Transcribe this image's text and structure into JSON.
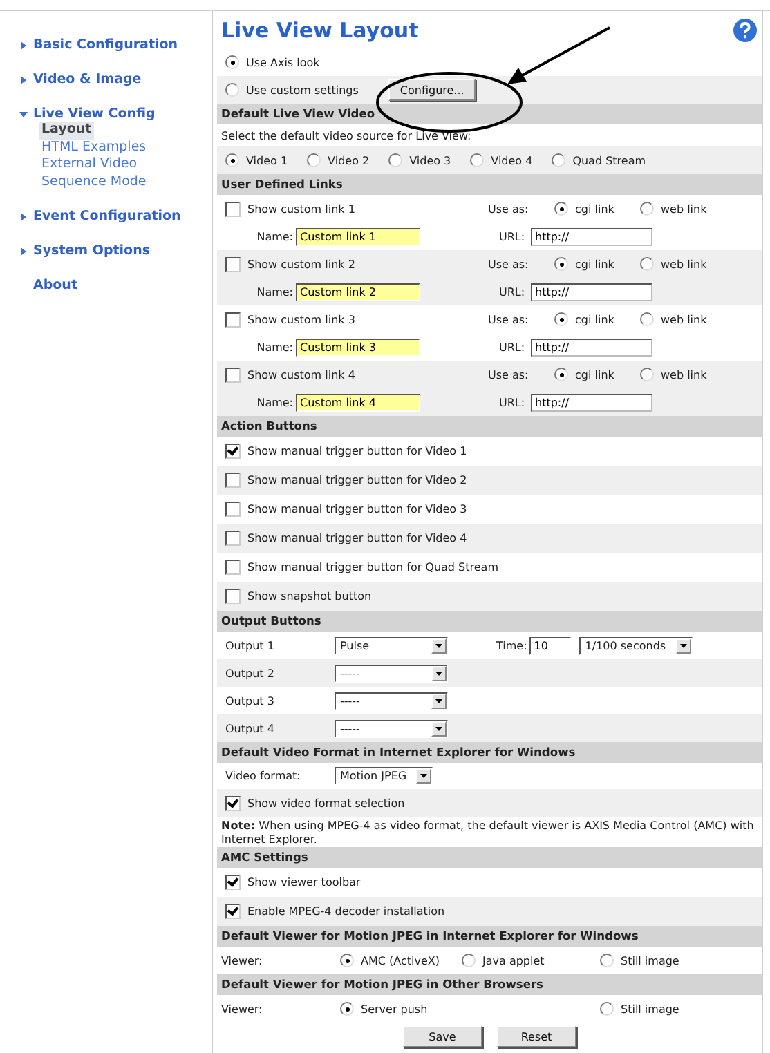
{
  "sidebar": {
    "items": [
      {
        "label": "Basic Configuration",
        "kind": "group",
        "expanded": false
      },
      {
        "label": "Video & Image",
        "kind": "group",
        "expanded": false
      },
      {
        "label": "Live View Config",
        "kind": "group",
        "expanded": true,
        "children": [
          {
            "label": "Layout",
            "selected": true
          },
          {
            "label": "HTML Examples",
            "selected": false
          },
          {
            "label": "External Video",
            "selected": false
          },
          {
            "label": "Sequence Mode",
            "selected": false
          }
        ]
      },
      {
        "label": "Event Configuration",
        "kind": "group",
        "expanded": false
      },
      {
        "label": "System Options",
        "kind": "group",
        "expanded": false
      },
      {
        "label": "About",
        "kind": "link"
      }
    ]
  },
  "title": "Live View Layout",
  "look": {
    "options": [
      {
        "label": "Use Axis look",
        "selected": true
      },
      {
        "label": "Use custom settings",
        "selected": false
      }
    ],
    "configure_button": "Configure..."
  },
  "default_video": {
    "heading": "Default Live View Video",
    "hint": "Select the default video source for Live View:",
    "options": [
      {
        "label": "Video 1",
        "selected": true
      },
      {
        "label": "Video 2",
        "selected": false
      },
      {
        "label": "Video 3",
        "selected": false
      },
      {
        "label": "Video 4",
        "selected": false
      },
      {
        "label": "Quad Stream",
        "selected": false
      }
    ]
  },
  "user_links": {
    "heading": "User Defined Links",
    "links": [
      {
        "label": "Show custom link 1",
        "checked": false,
        "use_as_label": "Use as:",
        "options": [
          {
            "label": "cgi link",
            "selected": true
          },
          {
            "label": "web link",
            "selected": false
          }
        ],
        "name_label": "Name:",
        "name_value": "Custom link 1",
        "url_label": "URL:",
        "url_value": "http://"
      },
      {
        "label": "Show custom link 2",
        "checked": false,
        "use_as_label": "Use as:",
        "options": [
          {
            "label": "cgi link",
            "selected": true
          },
          {
            "label": "web link",
            "selected": false
          }
        ],
        "name_label": "Name:",
        "name_value": "Custom link 2",
        "url_label": "URL:",
        "url_value": "http://"
      },
      {
        "label": "Show custom link 3",
        "checked": false,
        "use_as_label": "Use as:",
        "options": [
          {
            "label": "cgi link",
            "selected": true
          },
          {
            "label": "web link",
            "selected": false
          }
        ],
        "name_label": "Name:",
        "name_value": "Custom link 3",
        "url_label": "URL:",
        "url_value": "http://"
      },
      {
        "label": "Show custom link 4",
        "checked": false,
        "use_as_label": "Use as:",
        "options": [
          {
            "label": "cgi link",
            "selected": true
          },
          {
            "label": "web link",
            "selected": false
          }
        ],
        "name_label": "Name:",
        "name_value": "Custom link 4",
        "url_label": "URL:",
        "url_value": "http://"
      }
    ]
  },
  "action_buttons": {
    "heading": "Action Buttons",
    "items": [
      {
        "label": "Show manual trigger button for Video 1",
        "checked": true
      },
      {
        "label": "Show manual trigger button for Video 2",
        "checked": false
      },
      {
        "label": "Show manual trigger button for Video 3",
        "checked": false
      },
      {
        "label": "Show manual trigger button for Video 4",
        "checked": false
      },
      {
        "label": "Show manual trigger button for Quad Stream",
        "checked": false
      },
      {
        "label": "Show snapshot button",
        "checked": false
      }
    ]
  },
  "output_buttons": {
    "heading": "Output Buttons",
    "rows": [
      {
        "label": "Output 1",
        "value": "Pulse",
        "time_label": "Time:",
        "time_value": "10",
        "unit": "1/100 seconds"
      },
      {
        "label": "Output 2",
        "value": "-----"
      },
      {
        "label": "Output 3",
        "value": "-----"
      },
      {
        "label": "Output 4",
        "value": "-----"
      }
    ]
  },
  "video_format": {
    "heading": "Default Video Format in Internet Explorer for Windows",
    "format_label": "Video format:",
    "format_value": "Motion JPEG",
    "show_selection": {
      "label": "Show video format selection",
      "checked": true
    },
    "note": "**Note:** When using MPEG-4 as video format, the default viewer is AXIS Media Control (AMC) with Internet Explorer."
  },
  "amc": {
    "heading": "AMC Settings",
    "items": [
      {
        "label": "Show viewer toolbar",
        "checked": true
      },
      {
        "label": "Enable MPEG-4 decoder installation",
        "checked": true
      }
    ]
  },
  "viewer_ie": {
    "heading": "Default Viewer for Motion JPEG in Internet Explorer for Windows",
    "label": "Viewer:",
    "options": [
      {
        "label": "AMC (ActiveX)",
        "selected": true
      },
      {
        "label": "Java applet",
        "selected": false
      },
      {
        "label": "Still image",
        "selected": false
      }
    ]
  },
  "viewer_other": {
    "heading": "Default Viewer for Motion JPEG in Other Browsers",
    "label": "Viewer:",
    "options": [
      {
        "label": "Server push",
        "selected": true
      },
      {
        "label": "Still image",
        "selected": false
      }
    ]
  },
  "buttons": [
    "Save",
    "Reset"
  ]
}
